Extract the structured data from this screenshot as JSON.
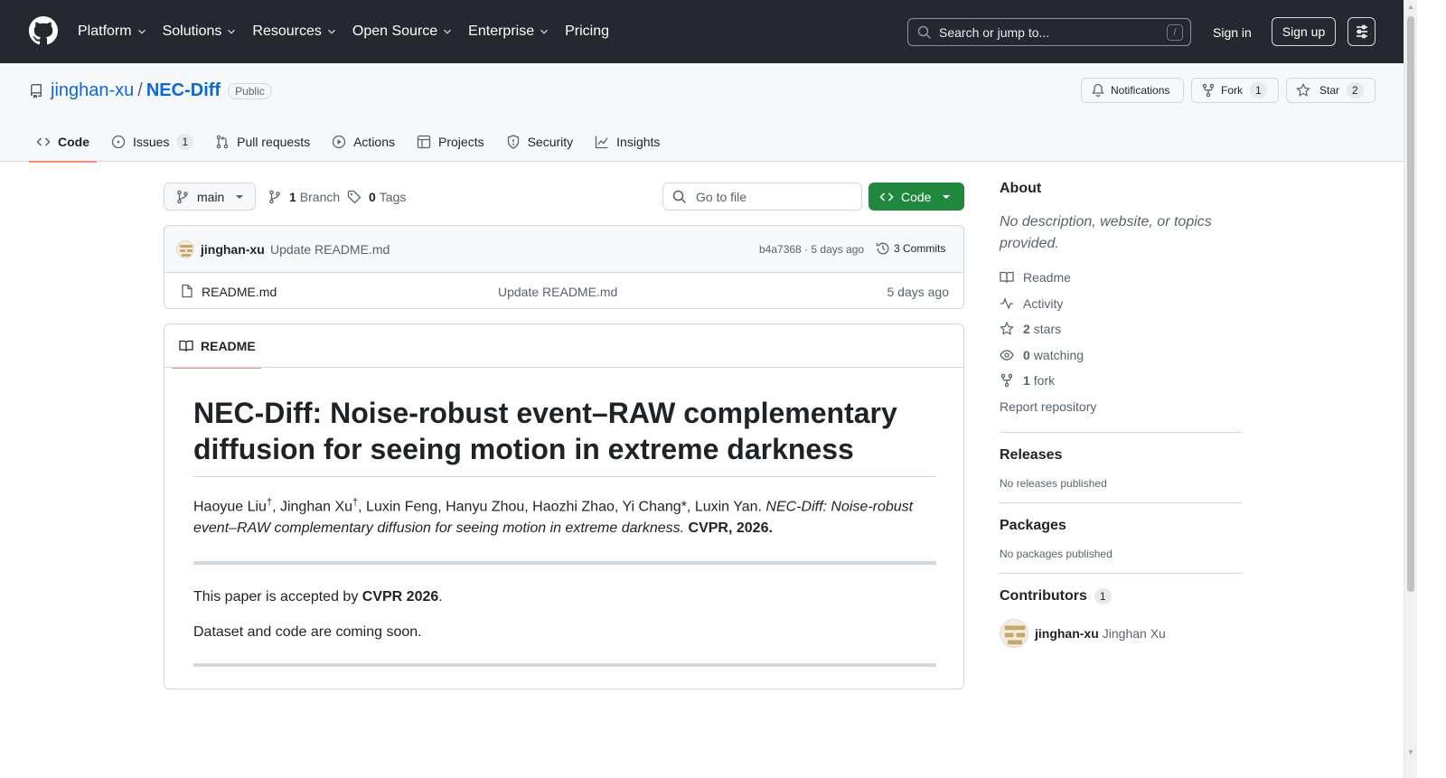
{
  "header": {
    "nav": [
      "Platform",
      "Solutions",
      "Resources",
      "Open Source",
      "Enterprise",
      "Pricing"
    ],
    "search_placeholder": "Search or jump to...",
    "search_shortcut": "/",
    "signin": "Sign in",
    "signup": "Sign up"
  },
  "repo": {
    "owner": "jinghan-xu",
    "separator": "/",
    "name": "NEC-Diff",
    "visibility": "Public",
    "notifications_label": "Notifications",
    "fork_label": "Fork",
    "fork_count": "1",
    "star_label": "Star",
    "star_count": "2"
  },
  "tabs": [
    {
      "label": "Code",
      "icon": "code-icon",
      "active": true
    },
    {
      "label": "Issues",
      "icon": "issue-icon",
      "count": "1"
    },
    {
      "label": "Pull requests",
      "icon": "pull-request-icon"
    },
    {
      "label": "Actions",
      "icon": "play-icon"
    },
    {
      "label": "Projects",
      "icon": "table-icon"
    },
    {
      "label": "Security",
      "icon": "shield-icon"
    },
    {
      "label": "Insights",
      "icon": "graph-icon"
    }
  ],
  "toolbar": {
    "branch": "main",
    "branch_count": "1",
    "branch_label": "Branch",
    "tag_count": "0",
    "tag_label": "Tags",
    "goto_placeholder": "Go to file",
    "code_button": "Code"
  },
  "latest_commit": {
    "author": "jinghan-xu",
    "message": "Update README.md",
    "hash_time": "b4a7368 · 5 days ago",
    "commits": "3 Commits"
  },
  "files": [
    {
      "name": "README.md",
      "message": "Update README.md",
      "time": "5 days ago"
    }
  ],
  "readme": {
    "tab": "README",
    "title": "NEC-Diff: Noise-robust event–RAW complementary diffusion for seeing motion in extreme darkness",
    "cite_authors_1": "Haoyue Liu",
    "cite_dagger": "†",
    "cite_authors_2": ", Jinghan Xu",
    "cite_authors_3": ", Luxin Feng, Hanyu Zhou, Haozhi Zhao, Yi Chang*, Luxin Yan. ",
    "cite_title": "NEC-Diff: Noise-robust event–RAW complementary diffusion for seeing motion in extreme darkness.",
    "cite_venue": "CVPR, 2026.",
    "accepted_prefix": "This paper is accepted by ",
    "accepted_venue": "CVPR 2026",
    "accepted_suffix": ".",
    "coming_soon": "Dataset and code are coming soon."
  },
  "sidebar": {
    "about_title": "About",
    "about_desc": "No description, website, or topics provided.",
    "readme_link": "Readme",
    "activity_link": "Activity",
    "stars_count": "2",
    "stars_label": "stars",
    "watching_count": "0",
    "watching_label": "watching",
    "fork_count": "1",
    "fork_label": "fork",
    "report": "Report repository",
    "releases_title": "Releases",
    "releases_note": "No releases published",
    "packages_title": "Packages",
    "packages_note": "No packages published",
    "contributors_title": "Contributors",
    "contributors_count": "1",
    "contributor_login": "jinghan-xu",
    "contributor_name": "Jinghan Xu"
  },
  "colors": {
    "header_bg": "#25292e",
    "link": "#0969da",
    "primary_button": "#1f883d",
    "active_tab_underline": "#fd8c73"
  }
}
